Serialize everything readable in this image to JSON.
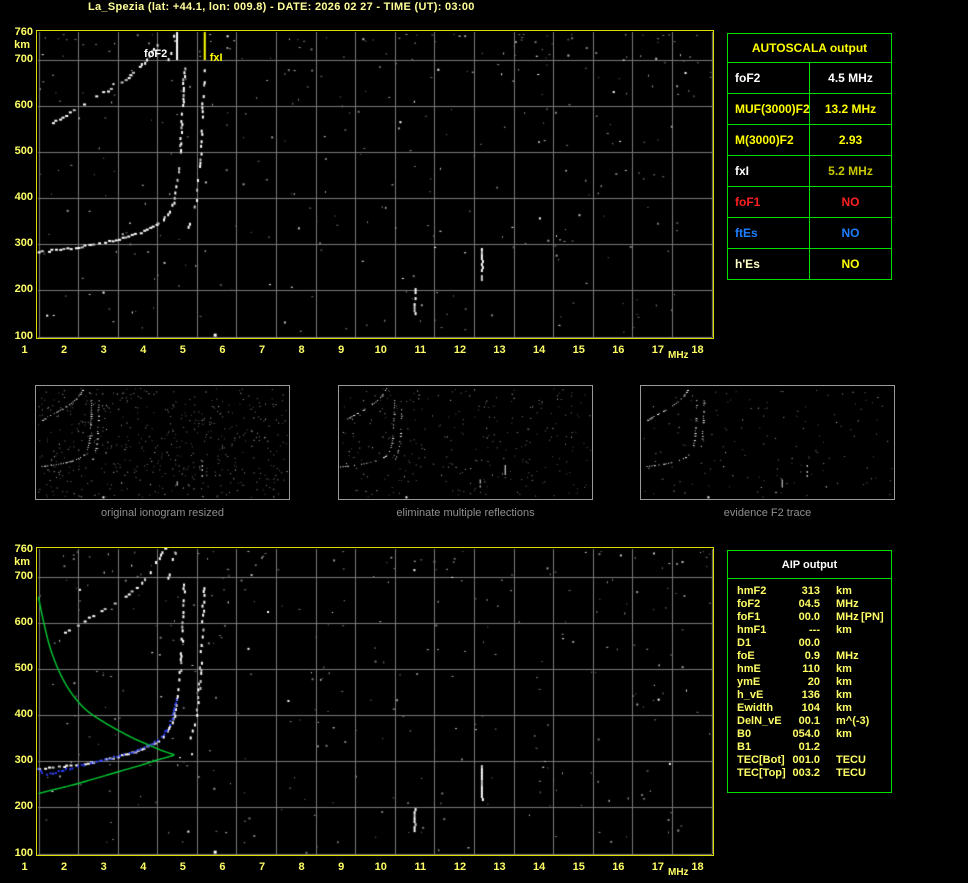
{
  "header": {
    "title": "La_Spezia (lat: +44.1, lon: 009.8) - DATE: 2026 02 27 - TIME (UT): 03:00"
  },
  "palette": {
    "background": "#000000",
    "axis_text": "#FFFF66",
    "plot_border": "#DDDD00",
    "grid": "#787878",
    "table_border": "#00DD00",
    "profile_green": "#00CC33",
    "restored_blue": "#2B3CFF",
    "caption_gray": "#8F8F8F"
  },
  "autoscala_table": {
    "title": "AUTOSCALA output",
    "rows": [
      {
        "label": "foF2",
        "value": "4.5 MHz",
        "label_color": "#FFFFFF",
        "value_color": "#FFFFFF"
      },
      {
        "label": "MUF(3000)F2",
        "value": "13.2 MHz",
        "label_color": "#FFFF00",
        "value_color": "#FFFF00"
      },
      {
        "label": "M(3000)F2",
        "value": "2.93",
        "label_color": "#FFFF00",
        "value_color": "#FFFF00"
      },
      {
        "label": "fxI",
        "value": "5.2 MHz",
        "label_color": "#FFFFFF",
        "value_color": "#C8C800"
      },
      {
        "label": "foF1",
        "value": "NO",
        "label_color": "#FF2020",
        "value_color": "#FF2020"
      },
      {
        "label": "ftEs",
        "value": "NO",
        "label_color": "#1E7FFF",
        "value_color": "#1E7FFF"
      },
      {
        "label": "h'Es",
        "value": "NO",
        "label_color": "#FFFFC8",
        "value_color": "#FFFF00"
      }
    ]
  },
  "aip_table": {
    "title": "AIP output",
    "rows": [
      {
        "label": "hmF2",
        "value": "313",
        "unit": "km",
        "extra": ""
      },
      {
        "label": "foF2",
        "value": "04.5",
        "unit": "MHz",
        "extra": ""
      },
      {
        "label": "foF1",
        "value": "00.0",
        "unit": "MHz",
        "extra": "[PN]"
      },
      {
        "label": "hmF1",
        "value": "---",
        "unit": "km",
        "extra": ""
      },
      {
        "label": "D1",
        "value": "00.0",
        "unit": "",
        "extra": ""
      },
      {
        "label": "foE",
        "value": "0.9",
        "unit": "MHz",
        "extra": ""
      },
      {
        "label": "hmE",
        "value": "110",
        "unit": "km",
        "extra": ""
      },
      {
        "label": "ymE",
        "value": "20",
        "unit": "km",
        "extra": ""
      },
      {
        "label": "h_vE",
        "value": "136",
        "unit": "km",
        "extra": ""
      },
      {
        "label": "Ewidth",
        "value": "104",
        "unit": "km",
        "extra": ""
      },
      {
        "label": "DelN_vE",
        "value": "00.1",
        "unit": "m^(-3)",
        "extra": ""
      },
      {
        "label": "B0",
        "value": "054.0",
        "unit": "km",
        "extra": ""
      },
      {
        "label": "B1",
        "value": "01.2",
        "unit": "",
        "extra": ""
      },
      {
        "label": "TEC[Bot]",
        "value": "001.0",
        "unit": "TECU",
        "extra": ""
      },
      {
        "label": "TEC[Top]",
        "value": "003.2",
        "unit": "TECU",
        "extra": ""
      }
    ]
  },
  "thumbnails": {
    "items": [
      {
        "caption": "original ionogram resized"
      },
      {
        "caption": "eliminate multiple reflections"
      },
      {
        "caption": "evidence F2 trace"
      }
    ]
  },
  "chart_data": [
    {
      "id": "ionogram-top",
      "type": "scatter",
      "description": "recorded vertical-incidence ionogram with autoscaled critical frequency markers",
      "x_axis": {
        "label": "MHz",
        "range": [
          1,
          18
        ],
        "ticks": [
          1,
          2,
          3,
          4,
          5,
          6,
          7,
          8,
          9,
          10,
          11,
          12,
          13,
          14,
          15,
          16,
          17,
          18
        ]
      },
      "y_axis": {
        "label": "km",
        "range": [
          100,
          760
        ],
        "ticks": [
          760,
          700,
          600,
          500,
          400,
          300,
          200,
          100
        ]
      },
      "markers": [
        {
          "name": "foF2",
          "freq_mhz": 4.5,
          "color": "#FFFFFF"
        },
        {
          "name": "fxI",
          "freq_mhz": 5.2,
          "color": "#FFFF00"
        }
      ],
      "echo_traces": {
        "f2_first_hop": [
          [
            1.0,
            283
          ],
          [
            1.4,
            287
          ],
          [
            1.8,
            291
          ],
          [
            2.2,
            296
          ],
          [
            2.6,
            302
          ],
          [
            3.0,
            310
          ],
          [
            3.3,
            317
          ],
          [
            3.6,
            326
          ],
          [
            3.9,
            338
          ],
          [
            4.1,
            350
          ],
          [
            4.25,
            365
          ],
          [
            4.38,
            385
          ],
          [
            4.47,
            412
          ],
          [
            4.54,
            450
          ],
          [
            4.59,
            500
          ],
          [
            4.63,
            560
          ],
          [
            4.66,
            625
          ],
          [
            4.69,
            685
          ]
        ],
        "f2_first_hop_x_mode": [
          [
            4.75,
            330
          ],
          [
            4.87,
            355
          ],
          [
            4.97,
            390
          ],
          [
            5.04,
            435
          ],
          [
            5.09,
            490
          ],
          [
            5.13,
            555
          ],
          [
            5.16,
            620
          ],
          [
            5.19,
            680
          ]
        ],
        "f2_second_hop": [
          [
            1.35,
            563
          ],
          [
            1.7,
            582
          ],
          [
            2.1,
            602
          ],
          [
            2.5,
            621
          ],
          [
            2.9,
            642
          ],
          [
            3.2,
            659
          ],
          [
            3.5,
            680
          ],
          [
            3.75,
            702
          ],
          [
            3.95,
            726
          ],
          [
            4.1,
            748
          ],
          [
            4.2,
            760
          ]
        ],
        "f2_second_hop_x_mode": [
          [
            4.3,
            700
          ],
          [
            4.38,
            725
          ],
          [
            4.45,
            755
          ]
        ]
      },
      "interference_streaks_mhz_km": [
        [
          10.5,
          150,
          205
        ],
        [
          12.2,
          220,
          292
        ]
      ],
      "isolated_echo_mhz_km": [
        5.45,
        104
      ]
    },
    {
      "id": "ionogram-bottom",
      "type": "scatter",
      "description": "same ionogram with restored F2 trace (blue) and electron density profile (green)",
      "profile_topside": [
        [
          1.0,
          657
        ],
        [
          1.12,
          606
        ],
        [
          1.3,
          545
        ],
        [
          1.55,
          490
        ],
        [
          1.85,
          446
        ],
        [
          2.2,
          412
        ],
        [
          2.6,
          388
        ],
        [
          3.0,
          368
        ],
        [
          3.4,
          350
        ],
        [
          3.8,
          335
        ],
        [
          4.1,
          324
        ],
        [
          4.3,
          318
        ],
        [
          4.42,
          314
        ]
      ],
      "profile_bottomside": [
        [
          4.42,
          314
        ],
        [
          4.25,
          309
        ],
        [
          4.0,
          303
        ],
        [
          3.6,
          292
        ],
        [
          3.2,
          282
        ],
        [
          2.8,
          272
        ],
        [
          2.4,
          262
        ],
        [
          2.0,
          252
        ],
        [
          1.6,
          243
        ],
        [
          1.3,
          237
        ],
        [
          1.0,
          230
        ]
      ],
      "restored_trace": [
        [
          1.0,
          284
        ],
        [
          1.1,
          276
        ],
        [
          1.25,
          272
        ],
        [
          1.45,
          276
        ],
        [
          1.7,
          282
        ],
        [
          2.0,
          289
        ],
        [
          2.3,
          295
        ],
        [
          2.6,
          301
        ],
        [
          2.9,
          308
        ],
        [
          3.2,
          315
        ],
        [
          3.5,
          324
        ],
        [
          3.8,
          335
        ],
        [
          4.0,
          346
        ],
        [
          4.15,
          358
        ],
        [
          4.28,
          374
        ],
        [
          4.38,
          394
        ],
        [
          4.45,
          416
        ],
        [
          4.5,
          438
        ]
      ],
      "profile_color": "#00CC33",
      "restored_trace_color": "#2B3CFF"
    }
  ]
}
